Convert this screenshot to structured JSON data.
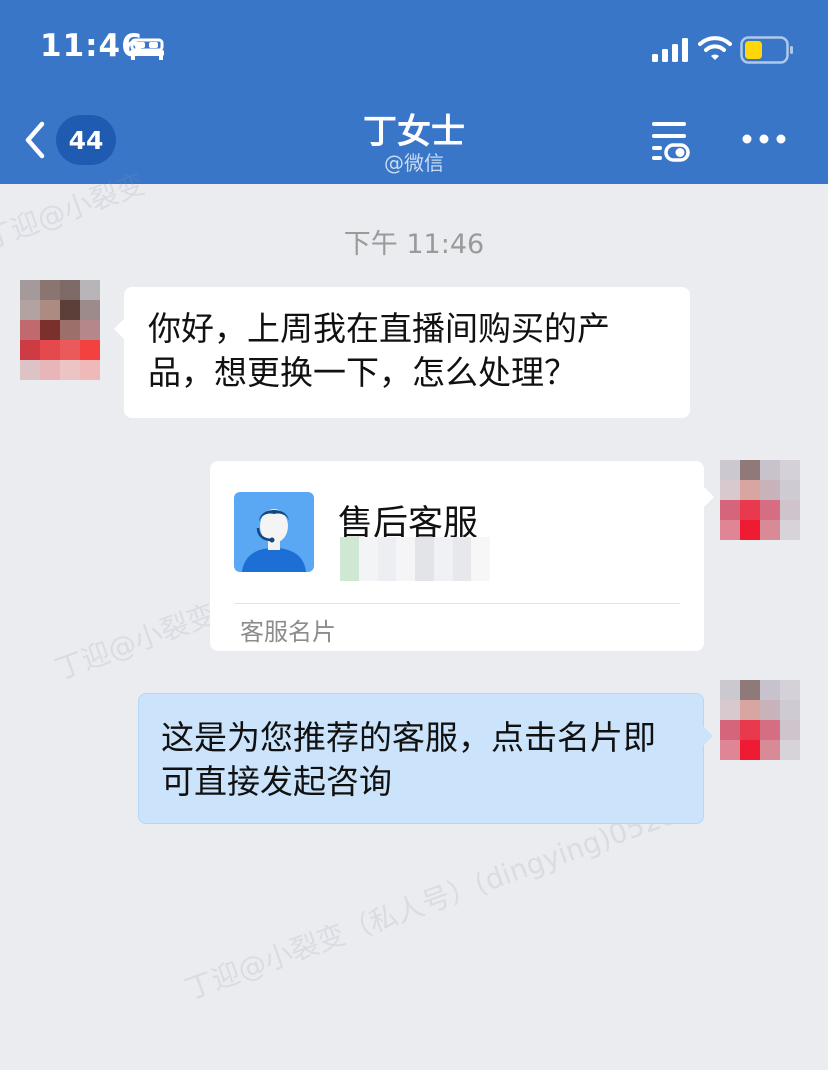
{
  "status_bar": {
    "time": "11:46"
  },
  "header": {
    "unread_count": "44",
    "contact_name": "丁女士",
    "contact_source": "@微信"
  },
  "chat": {
    "timestamp": "下午 11:46",
    "messages": [
      {
        "side": "incoming",
        "text": "你好，上周我在直播间购买的产品，想更换一下，怎么处理？"
      },
      {
        "side": "outgoing",
        "type": "card",
        "title": "售后客服",
        "label": "客服名片"
      },
      {
        "side": "outgoing",
        "text": "这是为您推荐的客服，点击名片即可直接发起咨询"
      }
    ]
  },
  "watermark": {
    "text_1": "丁迎@小裂变",
    "text_2": "丁迎@小裂变（私人号）(dingying)0523"
  },
  "colors": {
    "header_bg": "#3a76c8",
    "badge_bg": "#1f5bb0",
    "chat_bg": "#ebecf0",
    "outgoing_bubble": "#cce4fb",
    "incoming_bubble": "#ffffff",
    "battery_fill": "#ffd60a"
  },
  "icons": [
    "bed-icon",
    "signal-icon",
    "wifi-icon",
    "battery-icon",
    "back-chevron-icon",
    "filter-icon",
    "more-icon",
    "customer-service-avatar-icon"
  ]
}
